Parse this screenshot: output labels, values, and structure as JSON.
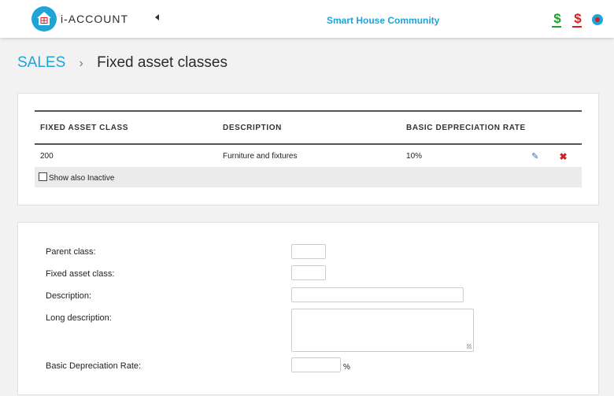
{
  "header": {
    "brand": "i-ACCOUNT",
    "company": "Smart House Community",
    "icons": [
      "house-logo-icon",
      "collapse-caret-icon",
      "dollar-green-icon",
      "dollar-red-icon",
      "lifebuoy-icon"
    ]
  },
  "breadcrumb": {
    "root": "SALES",
    "separator": "›",
    "current": "Fixed asset classes"
  },
  "table": {
    "headers": [
      "FIXED ASSET CLASS",
      "DESCRIPTION",
      "BASIC DEPRECIATION RATE"
    ],
    "rows": [
      {
        "class": "200",
        "description": "Furniture and fixtures",
        "rate": "10%"
      }
    ],
    "show_inactive_label": "Show also Inactive"
  },
  "form": {
    "parent_class_label": "Parent class:",
    "parent_class_value": "",
    "fixed_asset_class_label": "Fixed asset class:",
    "fixed_asset_class_value": "",
    "description_label": "Description:",
    "description_value": "",
    "long_description_label": "Long description:",
    "long_description_value": "",
    "rate_label": "Basic Depreciation Rate:",
    "rate_value": "",
    "rate_unit": "%"
  },
  "colors": {
    "accent": "#1fa4d8",
    "green": "#1fa02b",
    "red": "#d42020",
    "edit_blue": "#2a63c5"
  }
}
